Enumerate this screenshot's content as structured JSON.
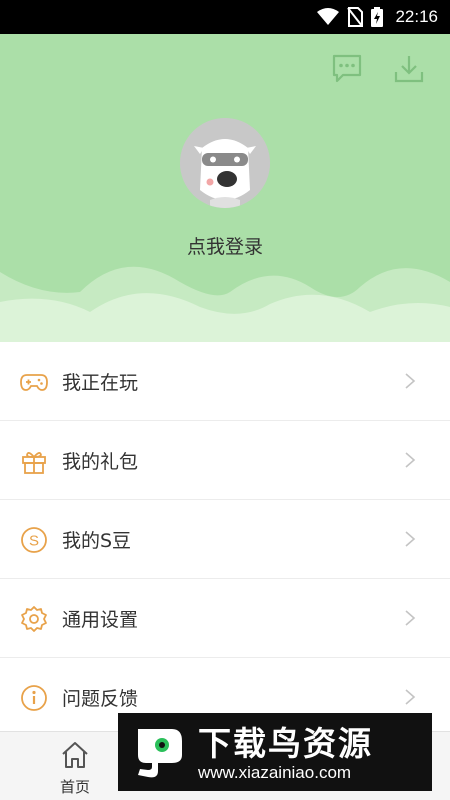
{
  "status_bar": {
    "time": "22:16",
    "icons": [
      "wifi-icon",
      "no-sim-icon",
      "battery-charging-icon"
    ]
  },
  "header": {
    "message_icon": "chat-bubble-icon",
    "download_icon": "download-icon",
    "login_text": "点我登录",
    "colors": {
      "background": "#abdfa8",
      "hills": "#d8f2d4"
    }
  },
  "menu": {
    "accent_color": "#e8a24a",
    "items": [
      {
        "label": "我正在玩",
        "icon": "gamepad-icon"
      },
      {
        "label": "我的礼包",
        "icon": "gift-icon"
      },
      {
        "label": "我的S豆",
        "icon": "s-coin-icon"
      },
      {
        "label": "通用设置",
        "icon": "gear-icon"
      },
      {
        "label": "问题反馈",
        "icon": "info-icon"
      }
    ]
  },
  "bottom_nav": {
    "home_label": "首页"
  },
  "watermark": {
    "title": "下载鸟资源",
    "url": "www.xiazainiao.com"
  }
}
